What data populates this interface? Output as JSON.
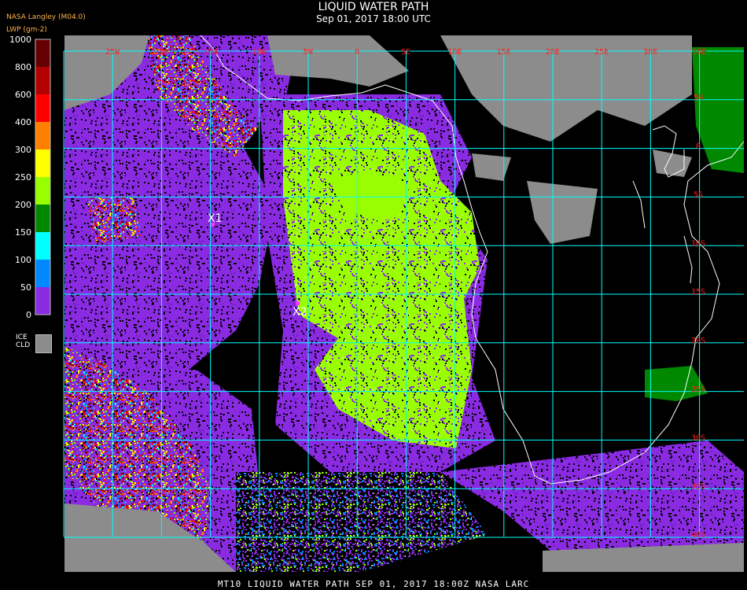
{
  "title": "LIQUID WATER PATH",
  "subtitle": "Sep 01, 2017 18:00 UTC",
  "producer": "NASA Langley (M04.0)",
  "units": "LWP (gm-2)",
  "footer": "MT10  LIQUID WATER PATH   SEP 01, 2017 18:00Z   NASA LARC",
  "legend": {
    "labels": [
      "1000",
      "800",
      "600",
      "400",
      "300",
      "250",
      "200",
      "150",
      "100",
      "50",
      "0"
    ],
    "colors": [
      "#660000",
      "#b30000",
      "#ff0000",
      "#ff8000",
      "#ffff00",
      "#99ff00",
      "#008800",
      "#00ffff",
      "#0088ff",
      "#0000ff",
      "#8a2be2"
    ],
    "ice_label_1": "ICE",
    "ice_label_2": "CLD",
    "ice_color": "#8c8c8c"
  },
  "map": {
    "lon_labels": [
      "25W",
      "20W",
      "15W",
      "10W",
      "5W",
      "0",
      "5E",
      "10E",
      "15E",
      "20E",
      "25E",
      "30E",
      "35E"
    ],
    "lat_labels": [
      "5N",
      "0",
      "5S",
      "10S",
      "15S",
      "20S",
      "25S",
      "30S",
      "35S",
      "40S"
    ],
    "grid_color": "#00ffff",
    "label_color": "#ff2020",
    "markers": [
      {
        "label": "X1",
        "color": "#ff33ff"
      },
      {
        "label": "X2",
        "color": "#ff33ff"
      }
    ]
  }
}
